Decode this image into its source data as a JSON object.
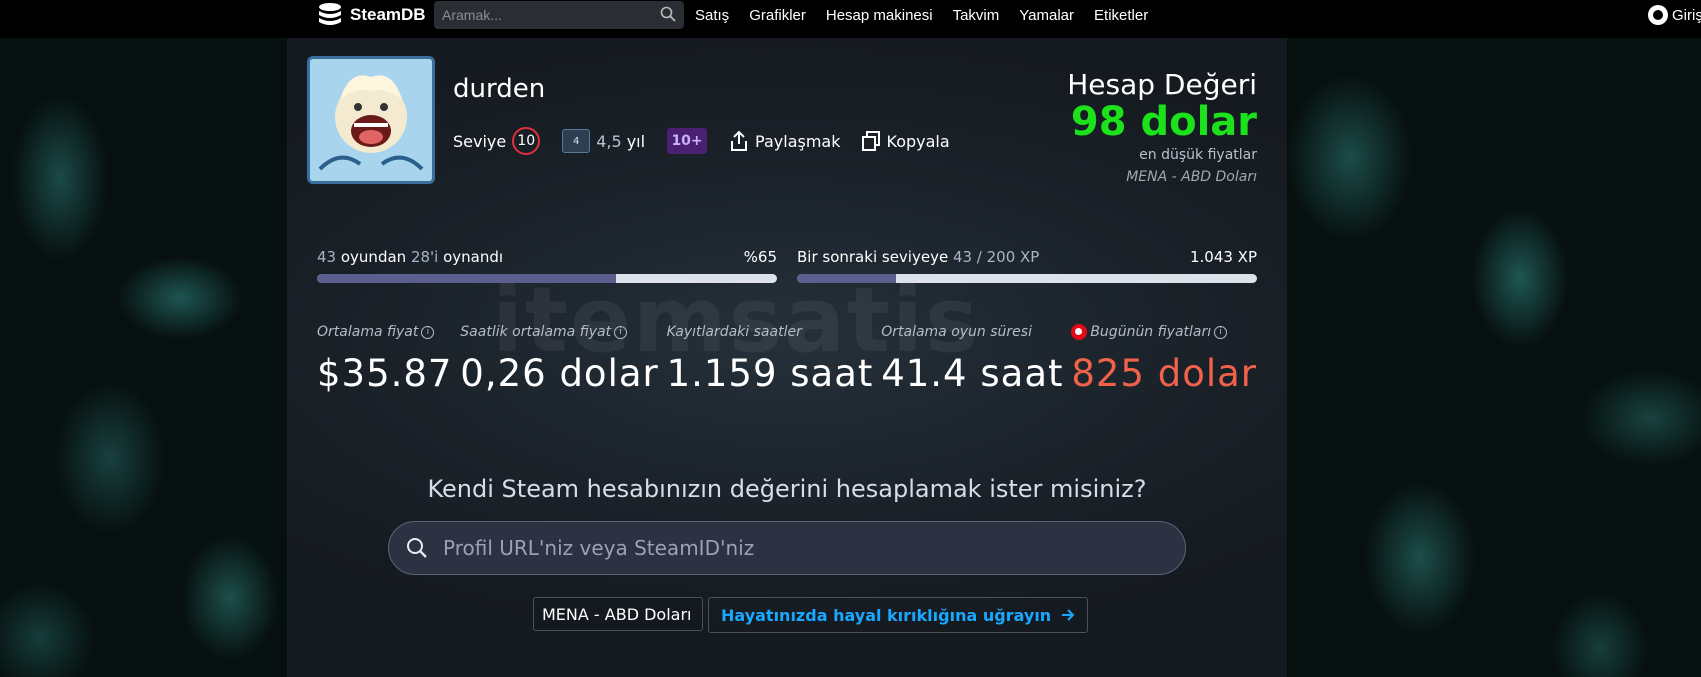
{
  "nav": {
    "logo_text": "SteamDB",
    "search_placeholder": "Aramak...",
    "links": [
      "Satış",
      "Grafikler",
      "Hesap makinesi",
      "Takvim",
      "Yamalar",
      "Etiketler"
    ],
    "login_label": "Giriş"
  },
  "profile": {
    "username": "durden",
    "level_label": "Seviye",
    "level": "10",
    "years_badge": "4",
    "years_value": "4,5",
    "years_unit": "yıl",
    "games_badge": "10+",
    "share_label": "Paylaşmak",
    "copy_label": "Kopyala"
  },
  "account_value": {
    "title": "Hesap Değeri",
    "amount": "98 dolar",
    "note": "en düşük fiyatlar",
    "region": "MENA - ABD Doları"
  },
  "progress": {
    "games": {
      "total": "43",
      "text_mid": "oyundan",
      "played": "28'i",
      "text_end": "oynandı",
      "percent_label": "%65",
      "fraction": 0.65
    },
    "xp": {
      "label": "Bir sonraki seviyeye",
      "current": "43 / 200 XP",
      "total": "1.043 XP",
      "fraction": 0.215
    }
  },
  "stats": [
    {
      "label": "Ortalama fiyat",
      "value": "$35.87",
      "info": true
    },
    {
      "label": "Saatlik ortalama fiyat",
      "value": "0,26 dolar",
      "info": true
    },
    {
      "label": "Kayıtlardaki saatler",
      "value": "1.159 saat",
      "info": false
    },
    {
      "label": "Ortalama oyun süresi",
      "value": "41.4 saat",
      "info": false
    },
    {
      "label": "Bugünün fiyatları",
      "value": "825 dolar",
      "info": true
    }
  ],
  "watermark": "itemsatis",
  "cta": {
    "heading": "Kendi Steam hesabınızın değerini hesaplamak ister misiniz?",
    "input_placeholder": "Profil URL'niz veya SteamID'niz",
    "region_value": "MENA - ABD Doları",
    "button_label": "Hayatınızda hayal kırıklığına uğrayın"
  },
  "colors": {
    "value_green": "#1ce21c",
    "price_red": "#f0624a",
    "link_blue": "#18a8ff",
    "level_red": "#e0303d"
  }
}
